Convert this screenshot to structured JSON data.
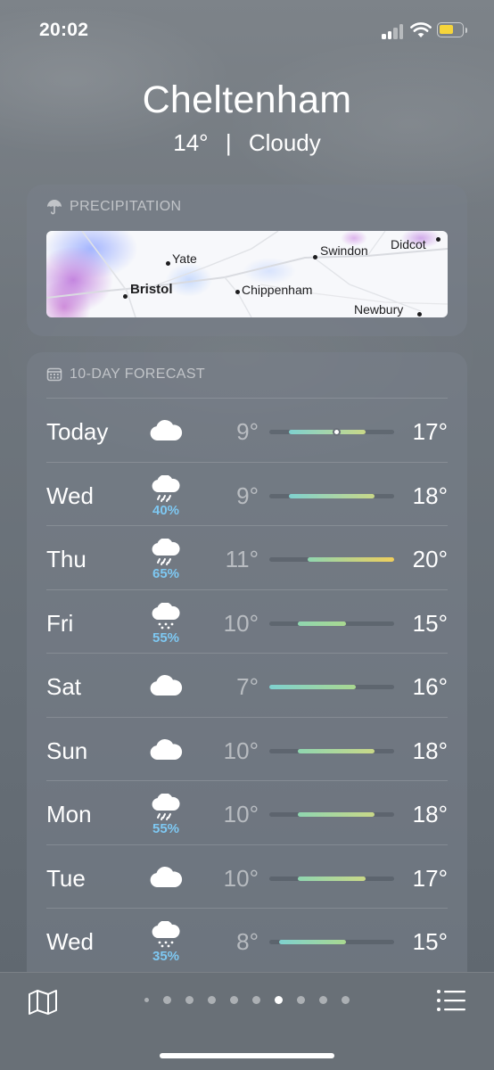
{
  "status_bar": {
    "time": "20:02"
  },
  "header": {
    "city": "Cheltenham",
    "temperature": "14°",
    "separator": "|",
    "condition": "Cloudy"
  },
  "precipitation": {
    "title": "PRECIPITATION",
    "map_labels": {
      "yate": "Yate",
      "swindon": "Swindon",
      "didcot": "Didcot",
      "bristol": "Bristol",
      "chippenham": "Chippenham",
      "newbury": "Newbury"
    }
  },
  "forecast": {
    "title": "10-DAY FORECAST",
    "scale_min": 7,
    "scale_max": 20,
    "days": [
      {
        "day": "Today",
        "icon": "cloud-icon",
        "pop": "",
        "low": "9°",
        "high": "17°",
        "low_val": 9,
        "high_val": 17,
        "current": 14
      },
      {
        "day": "Wed",
        "icon": "cloud-rain-icon",
        "pop": "40%",
        "low": "9°",
        "high": "18°",
        "low_val": 9,
        "high_val": 18
      },
      {
        "day": "Thu",
        "icon": "cloud-rain-icon",
        "pop": "65%",
        "low": "11°",
        "high": "20°",
        "low_val": 11,
        "high_val": 20
      },
      {
        "day": "Fri",
        "icon": "cloud-drizzle-icon",
        "pop": "55%",
        "low": "10°",
        "high": "15°",
        "low_val": 10,
        "high_val": 15
      },
      {
        "day": "Sat",
        "icon": "cloud-icon",
        "pop": "",
        "low": "7°",
        "high": "16°",
        "low_val": 7,
        "high_val": 16
      },
      {
        "day": "Sun",
        "icon": "cloud-icon",
        "pop": "",
        "low": "10°",
        "high": "18°",
        "low_val": 10,
        "high_val": 18
      },
      {
        "day": "Mon",
        "icon": "cloud-rain-icon",
        "pop": "55%",
        "low": "10°",
        "high": "18°",
        "low_val": 10,
        "high_val": 18
      },
      {
        "day": "Tue",
        "icon": "cloud-icon",
        "pop": "",
        "low": "10°",
        "high": "17°",
        "low_val": 10,
        "high_val": 17
      },
      {
        "day": "Wed",
        "icon": "cloud-drizzle-icon",
        "pop": "35%",
        "low": "8°",
        "high": "15°",
        "low_val": 8,
        "high_val": 15
      }
    ]
  },
  "bottom_bar": {
    "map_icon": "map-icon",
    "list_icon": "list-icon",
    "page_count": 10,
    "active_page": 7
  },
  "colors": {
    "pop_blue": "#7ec8f2",
    "battery_yellow": "#f6d53b"
  }
}
